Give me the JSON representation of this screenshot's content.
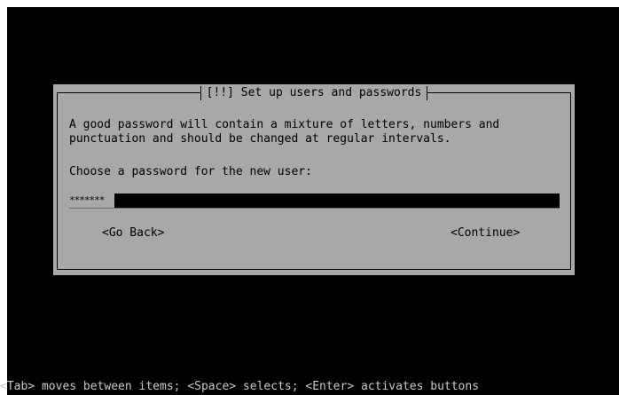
{
  "dialog": {
    "title": "[!!] Set up users and passwords",
    "description": "A good password will contain a mixture of letters, numbers and\npunctuation and should be changed at regular intervals.",
    "prompt": "Choose a password for the new user:",
    "password_mask": "*******",
    "go_back_label": "<Go Back>",
    "continue_label": "<Continue>"
  },
  "footer": {
    "help_text": "<Tab> moves between items; <Space> selects; <Enter> activates buttons"
  },
  "colors": {
    "screen_bg": "#000000",
    "dialog_bg": "#a8a8a8",
    "help_text": "#c8c8c8"
  }
}
